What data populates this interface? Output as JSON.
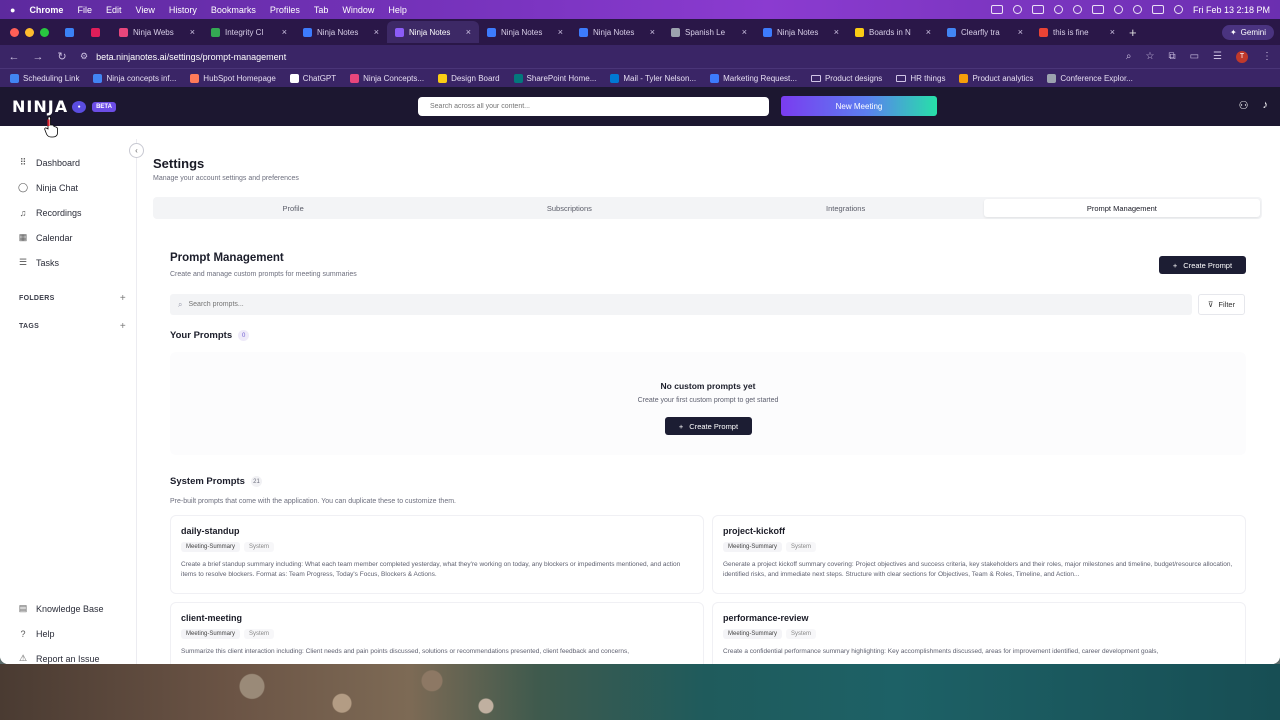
{
  "menubar": {
    "apple": "",
    "items": [
      "Chrome",
      "File",
      "Edit",
      "View",
      "History",
      "Bookmarks",
      "Profiles",
      "Tab",
      "Window",
      "Help"
    ],
    "datetime": "Fri Feb 13  2:18 PM"
  },
  "tabs": [
    {
      "label": "",
      "color": "#3b82f6",
      "pinned": true
    },
    {
      "label": "",
      "color": "#e01e5a",
      "pinned": true
    },
    {
      "label": "Ninja Webs",
      "color": "#e8467c"
    },
    {
      "label": "Integrity Cl",
      "color": "#34a853"
    },
    {
      "label": "Ninja Notes",
      "color": "#3d7bfd"
    },
    {
      "label": "Ninja Notes",
      "color": "#8b5cf6",
      "active": true
    },
    {
      "label": "Ninja Notes",
      "color": "#3d7bfd"
    },
    {
      "label": "Ninja Notes",
      "color": "#3d7bfd"
    },
    {
      "label": "Spanish Le",
      "color": "#9ca3af"
    },
    {
      "label": "Ninja Notes",
      "color": "#3d7bfd"
    },
    {
      "label": "Boards in N",
      "color": "#facc15"
    },
    {
      "label": "Clearfly tra",
      "color": "#4285f4"
    },
    {
      "label": "this is fine",
      "color": "#ea4335"
    }
  ],
  "gemini_label": "Gemini",
  "url": "beta.ninjanotes.ai/settings/prompt-management",
  "bookmarks": [
    {
      "label": "Scheduling Link",
      "color": "#4285f4"
    },
    {
      "label": "Ninja concepts inf...",
      "color": "#4285f4"
    },
    {
      "label": "HubSpot Homepage",
      "color": "#ff7a59"
    },
    {
      "label": "ChatGPT",
      "color": "#ffffff"
    },
    {
      "label": "Ninja Concepts...",
      "color": "#e8467c"
    },
    {
      "label": "Design Board",
      "color": "#facc15"
    },
    {
      "label": "SharePoint Home...",
      "color": "#03787c"
    },
    {
      "label": "Mail - Tyler Nelson...",
      "color": "#0078d4"
    },
    {
      "label": "Marketing Request...",
      "color": "#3d7bfd"
    },
    {
      "label": "Product designs",
      "color": "folder"
    },
    {
      "label": "HR things",
      "color": "folder"
    },
    {
      "label": "Product analytics",
      "color": "#f59e0b"
    },
    {
      "label": "Conference Explor...",
      "color": "#9ca3af"
    }
  ],
  "header": {
    "logo": "NINJA",
    "beta": "BETA",
    "search_placeholder": "Search across all your content...",
    "new_meeting": "New Meeting"
  },
  "sidebar": {
    "items": [
      {
        "label": "Dashboard",
        "icon": "grid-icon",
        "glyph": "⠿"
      },
      {
        "label": "Ninja Chat",
        "icon": "chat-icon",
        "glyph": "◯"
      },
      {
        "label": "Recordings",
        "icon": "headphones-icon",
        "glyph": "♫"
      },
      {
        "label": "Calendar",
        "icon": "calendar-icon",
        "glyph": "▦"
      },
      {
        "label": "Tasks",
        "icon": "tasks-icon",
        "glyph": "☰"
      }
    ],
    "folders": "FOLDERS",
    "tags": "TAGS",
    "bottom": [
      {
        "label": "Knowledge Base",
        "icon": "book-icon",
        "glyph": "▤"
      },
      {
        "label": "Help",
        "icon": "help-icon",
        "glyph": "?"
      },
      {
        "label": "Report an Issue",
        "icon": "alert-icon",
        "glyph": "⚠"
      }
    ]
  },
  "settings": {
    "title": "Settings",
    "subtitle": "Manage your account settings and preferences",
    "tabs": [
      "Profile",
      "Subscriptions",
      "Integrations",
      "Prompt Management"
    ],
    "active_tab": "Prompt Management"
  },
  "prompt_mgmt": {
    "title": "Prompt Management",
    "subtitle": "Create and manage custom prompts for meeting summaries",
    "create_label": "Create Prompt",
    "search_placeholder": "Search prompts...",
    "filter_label": "Filter",
    "your_prompts": "Your Prompts",
    "your_count": "0",
    "empty_title": "No custom prompts yet",
    "empty_sub": "Create your first custom prompt to get started",
    "system_prompts": "System Prompts",
    "system_count": "21",
    "system_sub": "Pre-built prompts that come with the application. You can duplicate these to customize them."
  },
  "cards": [
    {
      "name": "daily-standup",
      "tag": "Meeting-Summary",
      "sys": "System",
      "desc": "Create a brief standup summary including: What each team member completed yesterday, what they're working on today, any blockers or impediments mentioned, and action items to resolve blockers. Format as: Team Progress, Today's Focus, Blockers & Actions."
    },
    {
      "name": "project-kickoff",
      "tag": "Meeting-Summary",
      "sys": "System",
      "desc": "Generate a project kickoff summary covering: Project objectives and success criteria, key stakeholders and their roles, major milestones and timeline, budget/resource allocation, identified risks, and immediate next steps. Structure with clear sections for Objectives, Team & Roles, Timeline, and Action..."
    },
    {
      "name": "client-meeting",
      "tag": "Meeting-Summary",
      "sys": "System",
      "desc": "Summarize this client interaction including: Client needs and pain points discussed, solutions or recommendations presented, client feedback and concerns,"
    },
    {
      "name": "performance-review",
      "tag": "Meeting-Summary",
      "sys": "System",
      "desc": "Create a confidential performance summary highlighting: Key accomplishments discussed, areas for improvement identified, career development goals,"
    }
  ]
}
